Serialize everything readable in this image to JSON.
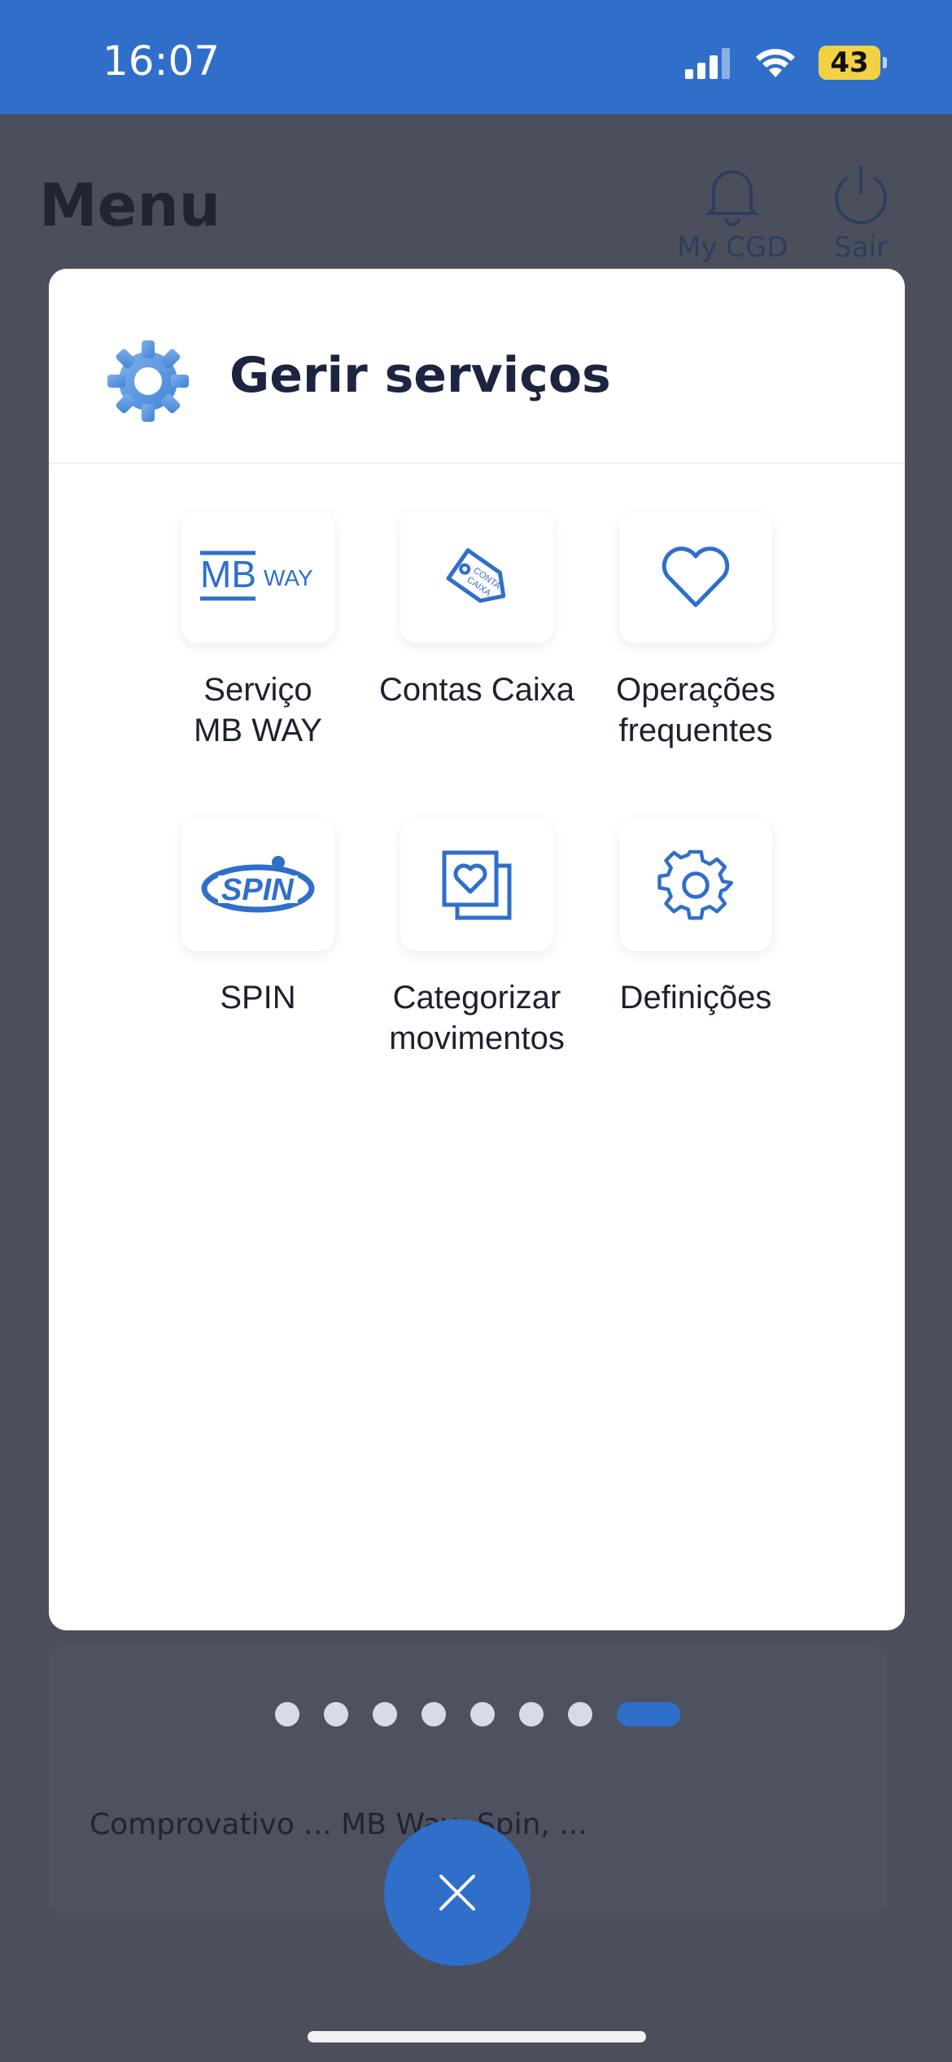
{
  "status_bar": {
    "time": "16:07",
    "battery": "43",
    "icons": [
      "signal-icon",
      "wifi-icon",
      "battery-icon"
    ]
  },
  "background": {
    "title": "Menu",
    "actions": [
      {
        "label": "My CGD",
        "icon": "bell-icon"
      },
      {
        "label": "Sair",
        "icon": "power-icon"
      }
    ],
    "card_text": "Comprovativo ... MB Way, Spin, ..."
  },
  "modal": {
    "title": "Gerir serviços",
    "icon": "gear-icon",
    "services": [
      {
        "label": "Serviço\nMB WAY",
        "icon": "mbway-logo-icon"
      },
      {
        "label": "Contas Caixa",
        "icon": "conta-caixa-tag-icon"
      },
      {
        "label": "Operações\nfrequentes",
        "icon": "heart-icon"
      },
      {
        "label": "SPIN",
        "icon": "spin-logo-icon"
      },
      {
        "label": "Categorizar\nmovimentos",
        "icon": "categorize-heart-icon"
      },
      {
        "label": "Definições",
        "icon": "gear-icon"
      }
    ]
  },
  "pager": {
    "count": 8,
    "active_index": 7
  },
  "colors": {
    "accent": "#2f6fca",
    "overlay": "#4b4f5c",
    "text": "#1d2130"
  }
}
